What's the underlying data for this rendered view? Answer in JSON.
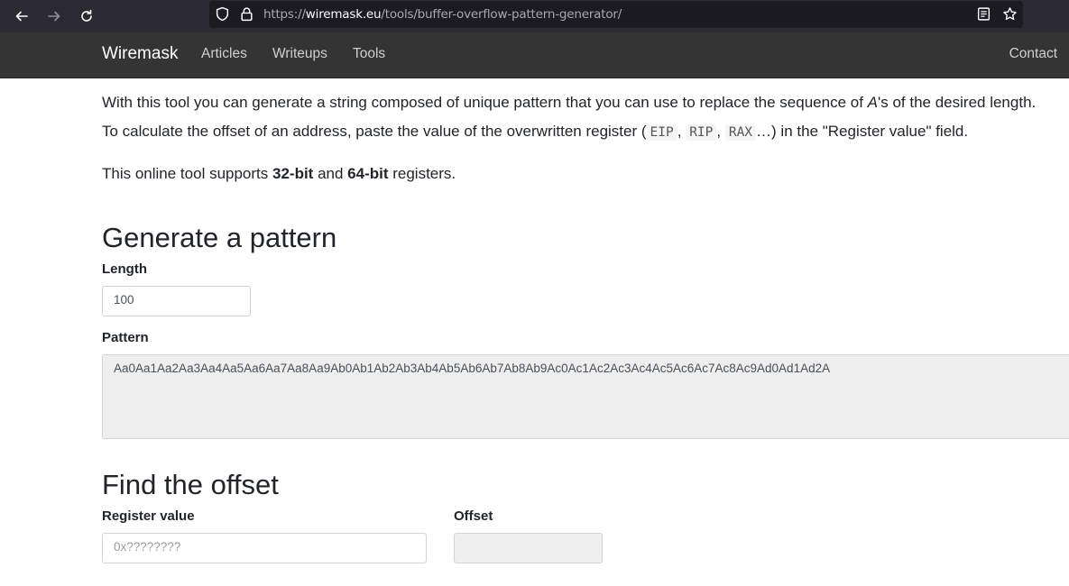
{
  "browser": {
    "url_prefix": "https://",
    "url_host": "wiremask.eu",
    "url_path": "/tools/buffer-overflow-pattern-generator/"
  },
  "navbar": {
    "brand": "Wiremask",
    "links": [
      "Articles",
      "Writeups",
      "Tools"
    ],
    "contact": "Contact"
  },
  "intro": {
    "line1_before": "With this tool you can generate a string composed of unique pattern that you can use to replace the sequence of ",
    "line1_em": "A",
    "line1_after": "'s of the desired length.",
    "line2_before": "To calculate the offset of an address, paste the value of the overwritten register (",
    "reg1": "EIP",
    "reg2": "RIP",
    "reg3": "RAX",
    "line2_after": "…) in the \"Register value\" field.",
    "line3_before": "This online tool supports ",
    "bit32": "32-bit",
    "line3_mid": " and ",
    "bit64": "64-bit",
    "line3_after": " registers."
  },
  "generate": {
    "heading": "Generate a pattern",
    "length_label": "Length",
    "length_value": "100",
    "pattern_label": "Pattern",
    "pattern_value": "Aa0Aa1Aa2Aa3Aa4Aa5Aa6Aa7Aa8Aa9Ab0Ab1Ab2Ab3Ab4Ab5Ab6Ab7Ab8Ab9Ac0Ac1Ac2Ac3Ac4Ac5Ac6Ac7Ac8Ac9Ad0Ad1Ad2A"
  },
  "find": {
    "heading": "Find the offset",
    "register_label": "Register value",
    "register_placeholder": "0x????????",
    "offset_label": "Offset"
  }
}
